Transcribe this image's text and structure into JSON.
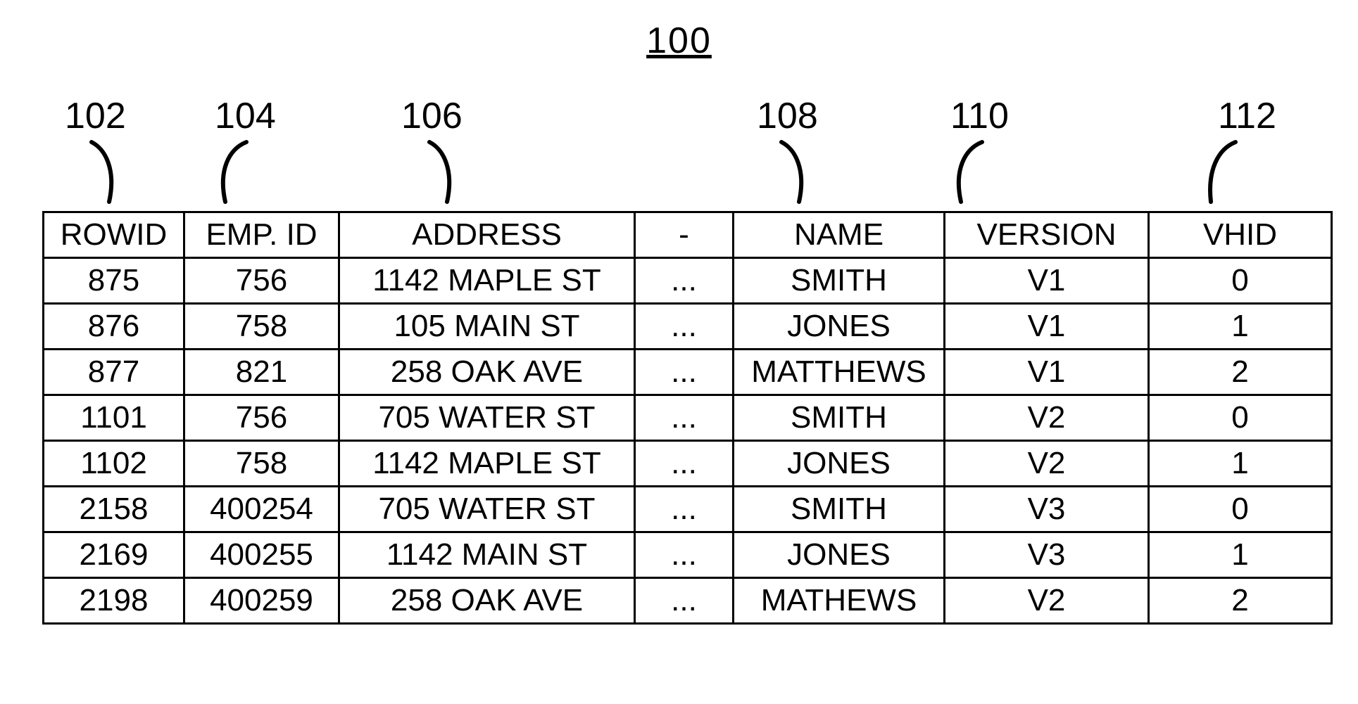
{
  "figure_title": "100",
  "refs": {
    "r102": "102",
    "r104": "104",
    "r106": "106",
    "r108": "108",
    "r110": "110",
    "r112": "112"
  },
  "table": {
    "headers": [
      "ROWID",
      "EMP. ID",
      "ADDRESS",
      "-",
      "NAME",
      "VERSION",
      "VHID"
    ],
    "rows": [
      [
        "875",
        "756",
        "1142 MAPLE ST",
        "...",
        "SMITH",
        "V1",
        "0"
      ],
      [
        "876",
        "758",
        "105 MAIN ST",
        "...",
        "JONES",
        "V1",
        "1"
      ],
      [
        "877",
        "821",
        "258 OAK AVE",
        "...",
        "MATTHEWS",
        "V1",
        "2"
      ],
      [
        "1101",
        "756",
        "705 WATER ST",
        "...",
        "SMITH",
        "V2",
        "0"
      ],
      [
        "1102",
        "758",
        "1142 MAPLE ST",
        "...",
        "JONES",
        "V2",
        "1"
      ],
      [
        "2158",
        "400254",
        "705 WATER ST",
        "...",
        "SMITH",
        "V3",
        "0"
      ],
      [
        "2169",
        "400255",
        "1142 MAIN ST",
        "...",
        "JONES",
        "V3",
        "1"
      ],
      [
        "2198",
        "400259",
        "258 OAK AVE",
        "...",
        "MATHEWS",
        "V2",
        "2"
      ]
    ]
  },
  "chart_data": {
    "type": "table",
    "title": "100",
    "column_refs": {
      "ROWID": "102",
      "EMP. ID": "104",
      "ADDRESS": "106",
      "NAME": "108",
      "VERSION": "110",
      "VHID": "112"
    },
    "columns": [
      "ROWID",
      "EMP. ID",
      "ADDRESS",
      "-",
      "NAME",
      "VERSION",
      "VHID"
    ],
    "rows": [
      {
        "ROWID": 875,
        "EMP. ID": 756,
        "ADDRESS": "1142 MAPLE ST",
        "-": "...",
        "NAME": "SMITH",
        "VERSION": "V1",
        "VHID": 0
      },
      {
        "ROWID": 876,
        "EMP. ID": 758,
        "ADDRESS": "105 MAIN ST",
        "-": "...",
        "NAME": "JONES",
        "VERSION": "V1",
        "VHID": 1
      },
      {
        "ROWID": 877,
        "EMP. ID": 821,
        "ADDRESS": "258 OAK AVE",
        "-": "...",
        "NAME": "MATTHEWS",
        "VERSION": "V1",
        "VHID": 2
      },
      {
        "ROWID": 1101,
        "EMP. ID": 756,
        "ADDRESS": "705 WATER ST",
        "-": "...",
        "NAME": "SMITH",
        "VERSION": "V2",
        "VHID": 0
      },
      {
        "ROWID": 1102,
        "EMP. ID": 758,
        "ADDRESS": "1142 MAPLE ST",
        "-": "...",
        "NAME": "JONES",
        "VERSION": "V2",
        "VHID": 1
      },
      {
        "ROWID": 2158,
        "EMP. ID": 400254,
        "ADDRESS": "705 WATER ST",
        "-": "...",
        "NAME": "SMITH",
        "VERSION": "V3",
        "VHID": 0
      },
      {
        "ROWID": 2169,
        "EMP. ID": 400255,
        "ADDRESS": "1142 MAIN ST",
        "-": "...",
        "NAME": "JONES",
        "VERSION": "V3",
        "VHID": 1
      },
      {
        "ROWID": 2198,
        "EMP. ID": 400259,
        "ADDRESS": "258 OAK AVE",
        "-": "...",
        "NAME": "MATHEWS",
        "VERSION": "V2",
        "VHID": 2
      }
    ]
  }
}
